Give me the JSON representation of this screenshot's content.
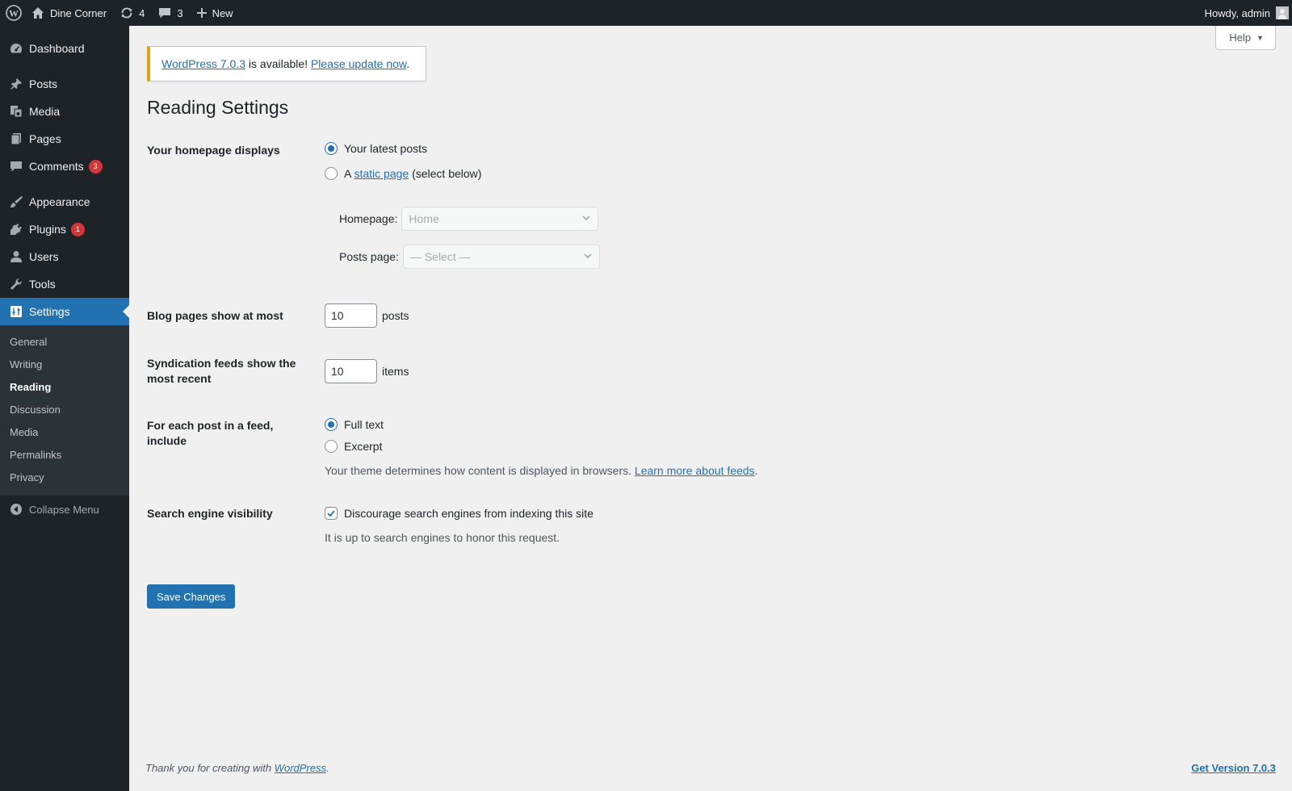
{
  "adminbar": {
    "site_name": "Dine Corner",
    "updates_count": "4",
    "comments_count": "3",
    "new_label": "New",
    "howdy": "Howdy, admin"
  },
  "sidebar": {
    "items": [
      {
        "label": "Dashboard"
      },
      {
        "label": "Posts"
      },
      {
        "label": "Media"
      },
      {
        "label": "Pages"
      },
      {
        "label": "Comments",
        "badge": "3"
      },
      {
        "label": "Appearance"
      },
      {
        "label": "Plugins",
        "badge": "1"
      },
      {
        "label": "Users"
      },
      {
        "label": "Tools"
      },
      {
        "label": "Settings"
      }
    ],
    "submenu": [
      "General",
      "Writing",
      "Reading",
      "Discussion",
      "Media",
      "Permalinks",
      "Privacy"
    ],
    "collapse_label": "Collapse Menu"
  },
  "help_label": "Help",
  "notice": {
    "version_link": "WordPress 7.0.3",
    "middle_text": " is available! ",
    "update_link": "Please update now",
    "end_text": "."
  },
  "page_title": "Reading Settings",
  "homepage_displays": {
    "label": "Your homepage displays",
    "option_latest": "Your latest posts",
    "option_static_prefix": "A ",
    "option_static_link": "static page",
    "option_static_suffix": " (select below)",
    "homepage_label": "Homepage:",
    "homepage_value": "Home",
    "posts_page_label": "Posts page:",
    "posts_page_value": "— Select —",
    "selected": "latest"
  },
  "blog_pages": {
    "label": "Blog pages show at most",
    "value": "10",
    "unit": "posts"
  },
  "syndication": {
    "label": "Syndication feeds show the most recent",
    "value": "10",
    "unit": "items"
  },
  "feed_include": {
    "label": "For each post in a feed, include",
    "option_full": "Full text",
    "option_excerpt": "Excerpt",
    "selected": "full",
    "desc_text": "Your theme determines how content is displayed in browsers. ",
    "desc_link": "Learn more about feeds",
    "desc_end": "."
  },
  "search_visibility": {
    "label": "Search engine visibility",
    "checkbox_label": "Discourage search engines from indexing this site",
    "checked": true,
    "desc": "It is up to search engines to honor this request."
  },
  "save_label": "Save Changes",
  "footer": {
    "thanks_text": "Thank you for creating with ",
    "thanks_link": "WordPress",
    "thanks_end": ".",
    "version_link": "Get Version 7.0.3"
  },
  "colors": {
    "adminbar_bg": "#1d2327",
    "accent": "#2271b1",
    "badge": "#d63638",
    "notice_warning": "#dba617"
  }
}
